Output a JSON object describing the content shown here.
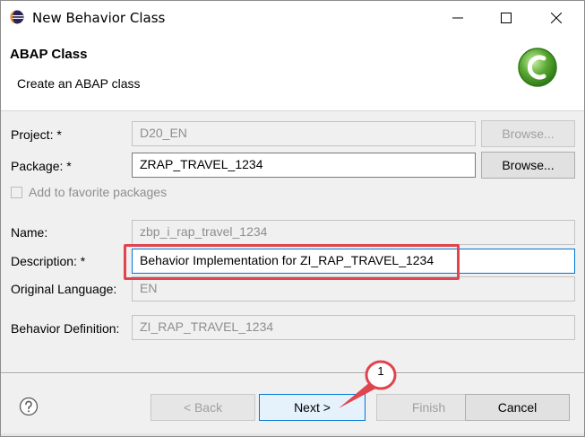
{
  "window": {
    "title": "New Behavior Class"
  },
  "banner": {
    "title": "ABAP Class",
    "subtitle": "Create an ABAP class"
  },
  "form": {
    "project": {
      "label": "Project: *",
      "value": "D20_EN",
      "browse_label": "Browse..."
    },
    "package": {
      "label": "Package: *",
      "value": "ZRAP_TRAVEL_1234",
      "browse_label": "Browse..."
    },
    "favorite": {
      "label": "Add to favorite packages",
      "checked": false
    },
    "name": {
      "label": "Name:",
      "value": "zbp_i_rap_travel_1234"
    },
    "description": {
      "label": "Description: *",
      "value": "Behavior Implementation for ZI_RAP_TRAVEL_1234"
    },
    "original_language": {
      "label": "Original Language:",
      "value": "EN"
    },
    "behavior_definition": {
      "label": "Behavior Definition:",
      "value": "ZI_RAP_TRAVEL_1234"
    }
  },
  "footer": {
    "back_label": "< Back",
    "next_label": "Next >",
    "finish_label": "Finish",
    "cancel_label": "Cancel"
  },
  "callout": {
    "number": "1"
  },
  "colors": {
    "highlight": "#e0444d",
    "focus": "#0078d7",
    "eclipse_green": "#5aa832"
  },
  "icons": {
    "app": "eclipse-icon",
    "logo": "abap-class-logo-icon",
    "help": "help-icon"
  }
}
